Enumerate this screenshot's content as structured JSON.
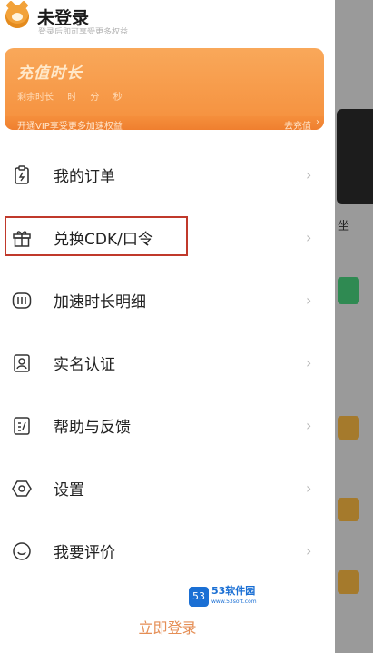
{
  "profile": {
    "username": "未登录",
    "subtitle": "登录后即可享受更多权益"
  },
  "membership_card": {
    "title": "充值时长",
    "remaining_label": "剩余时长",
    "remaining_units": [
      "时",
      "分",
      "秒"
    ],
    "hint": "开通VIP享受更多加速权益",
    "recharge_label": "去充值",
    "colors": {
      "card_top": "#f9a85a",
      "card_bottom": "#f58f3c"
    }
  },
  "menu": {
    "items": [
      {
        "label": "我的订单",
        "icon": "order-icon"
      },
      {
        "label": "兑换CDK/口令",
        "icon": "gift-icon"
      },
      {
        "label": "加速时长明细",
        "icon": "speed-detail-icon"
      },
      {
        "label": "实名认证",
        "icon": "id-card-icon"
      },
      {
        "label": "帮助与反馈",
        "icon": "help-feedback-icon"
      },
      {
        "label": "设置",
        "icon": "settings-icon"
      },
      {
        "label": "我要评价",
        "icon": "review-icon"
      }
    ],
    "chevron": "›"
  },
  "footer": {
    "login_label": "立即登录"
  },
  "watermark": {
    "brand": "53软件园",
    "url": "www.53soft.com",
    "logo_text": "53"
  },
  "colors": {
    "highlight": "#c0392b",
    "login_accent": "#e58e55"
  }
}
